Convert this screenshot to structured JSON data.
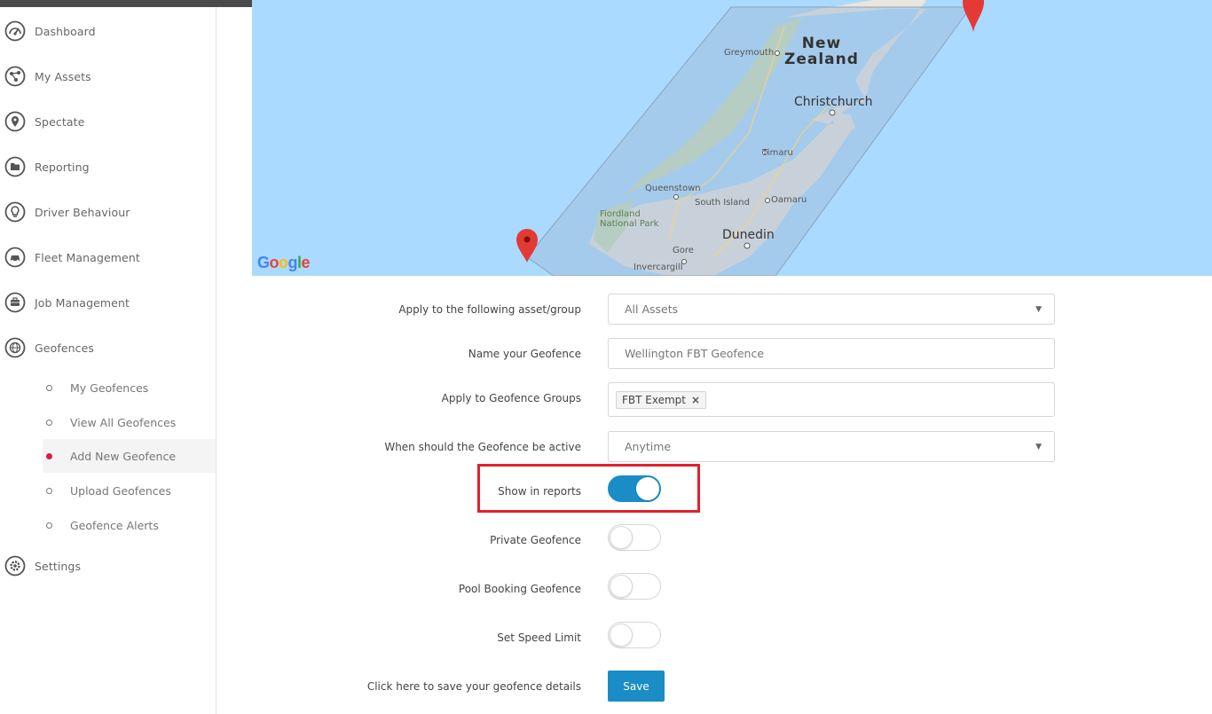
{
  "sidebar": {
    "items": [
      {
        "label": "Dashboard",
        "icon": "dashboard-gauge-icon"
      },
      {
        "label": "My Assets",
        "icon": "network-nodes-icon"
      },
      {
        "label": "Spectate",
        "icon": "map-pin-icon"
      },
      {
        "label": "Reporting",
        "icon": "report-folder-icon"
      },
      {
        "label": "Driver Behaviour",
        "icon": "lightbulb-icon"
      },
      {
        "label": "Fleet Management",
        "icon": "car-icon"
      },
      {
        "label": "Job Management",
        "icon": "briefcase-icon"
      },
      {
        "label": "Geofences",
        "icon": "globe-icon"
      },
      {
        "label": "Settings",
        "icon": "gear-icon"
      }
    ],
    "geofence_subitems": [
      {
        "label": "My Geofences",
        "active": false
      },
      {
        "label": "View All Geofences",
        "active": false
      },
      {
        "label": "Add New Geofence",
        "active": true
      },
      {
        "label": "Upload Geofences",
        "active": false
      },
      {
        "label": "Geofence Alerts",
        "active": false
      }
    ]
  },
  "map": {
    "labels": {
      "country_line1": "New",
      "country_line2": "Zealand",
      "christchurch": "Christchurch",
      "dunedin": "Dunedin",
      "greymouth": "Greymouth",
      "timaru": "Timaru",
      "queenstown": "Queenstown",
      "south_island": "South Island",
      "oamaru": "Oamaru",
      "fiordland_line1": "Fiordland",
      "fiordland_line2": "National Park",
      "gore": "Gore",
      "invercargill": "Invercargill"
    },
    "logo_letters": [
      "G",
      "o",
      "o",
      "g",
      "l",
      "e"
    ],
    "colors": {
      "water": "#aadaff",
      "land": "#e9e6df",
      "geofence": "#9fb8d4",
      "pin": "#e53935"
    }
  },
  "form": {
    "asset_group": {
      "label": "Apply to the following asset/group",
      "value": "All Assets"
    },
    "name": {
      "label": "Name your Geofence",
      "value": "Wellington FBT Geofence"
    },
    "groups": {
      "label": "Apply to Geofence Groups",
      "tag": "FBT Exempt",
      "remove_icon": "×"
    },
    "active_time": {
      "label": "When should the Geofence be active",
      "value": "Anytime"
    },
    "toggles": {
      "show_in_reports": {
        "label": "Show in reports",
        "on": true
      },
      "private": {
        "label": "Private Geofence",
        "on": false
      },
      "pool_booking": {
        "label": "Pool Booking Geofence",
        "on": false
      },
      "speed_limit": {
        "label": "Set Speed Limit",
        "on": false
      }
    },
    "save": {
      "label": "Click here to save your geofence details",
      "button": "Save"
    }
  },
  "colors": {
    "accent": "#1a8dc6",
    "active_dot": "#d21f4c",
    "highlight_box": "#e3202a",
    "sidebar_text": "#666666"
  }
}
